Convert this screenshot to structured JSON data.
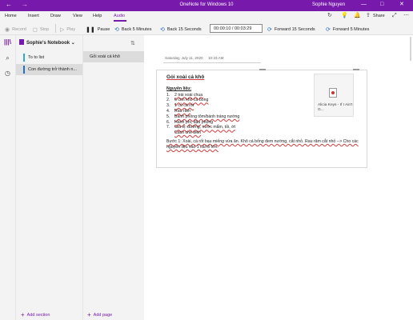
{
  "window": {
    "title": "OneNote for Windows 10",
    "user": "Sophie Nguyen",
    "back": "←",
    "forward": "→",
    "minimize": "—",
    "maximize": "□",
    "close": "✕"
  },
  "tabs": [
    {
      "label": "Home"
    },
    {
      "label": "Insert"
    },
    {
      "label": "Draw"
    },
    {
      "label": "View"
    },
    {
      "label": "Help"
    },
    {
      "label": "Audio"
    }
  ],
  "ribbon_right": {
    "sync_icon": "↻",
    "bulb_icon": "💡",
    "bell_icon": "🔔",
    "share_icon": "⇪",
    "share_label": "Share",
    "expand_icon": "⤢",
    "more_icon": "⋯"
  },
  "toolbar": {
    "record": "Record",
    "stop": "Stop",
    "play": "Play",
    "pause": "Pause",
    "back5": "Back 5 Minutes",
    "back15": "Back 15 Seconds",
    "time": "00:00:10 / 00:03:29",
    "fwd15": "Forward 15 Seconds",
    "fwd5": "Forward 5 Minutes"
  },
  "notebook": {
    "name": "Sophie's Notebook",
    "chevron": "⌄",
    "sections": [
      {
        "label": "To to list",
        "color": "#2fa8d9"
      },
      {
        "label": "Con đường trở thành n...",
        "color": "#1f6fd0"
      }
    ],
    "add_section": "Add section"
  },
  "pages": {
    "items": [
      {
        "label": "Gỏi xoài cá khô"
      }
    ],
    "add_page": "Add page"
  },
  "page": {
    "date": "Saturday, July 11, 2020",
    "time": "10:33 AM",
    "title": "Gỏi xoài cá khô",
    "ingredients_heading": "Nguyên liệu:",
    "ingredients": [
      {
        "n": "1.",
        "text": "2 trái xoài chua"
      },
      {
        "n": "2.",
        "text": "6 con khô cá bống"
      },
      {
        "n": "3.",
        "text": "1 củ cà rốt"
      },
      {
        "n": "4.",
        "text": "Rau răm"
      },
      {
        "n": "5.",
        "text": "Bánh phồng tôm/bánh tráng nướng"
      },
      {
        "n": "6.",
        "text": "Hành phi, đậu phộng"
      },
      {
        "n": "7.",
        "text": "Gia vị: đường, nước mắm, tỏi, ớt"
      },
      {
        "n": "",
        "text": "Cách chế biến"
      }
    ],
    "step1": "Bước 1: Xoài, cà rốt bạu miếng vừa ăn. Khô cá bống đem nướng, cắt nhỏ. Rau răm cắt nhỏ --> Cho các nguyên liệu vào 1 cái tô lớn.",
    "attachment": "Alicia Keys - If I Ain't G..."
  },
  "colors": {
    "accent": "#7719aa",
    "spellcheck": "#d23b3b"
  }
}
